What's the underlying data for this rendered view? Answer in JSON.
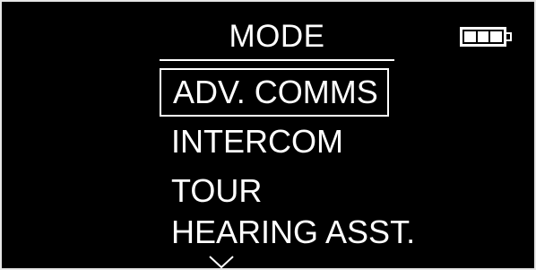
{
  "screen": {
    "title": "MODE",
    "battery": {
      "icon": "battery-icon",
      "level": "3 of 3 bars"
    },
    "menu": {
      "items": [
        {
          "label": "ADV. COMMS",
          "selected": true
        },
        {
          "label": "INTERCOM",
          "selected": false
        },
        {
          "label": "TOUR",
          "selected": false
        },
        {
          "label": "HEARING ASST.",
          "selected": false
        }
      ]
    },
    "scroll_indicator": {
      "icon": "chevron-down-icon"
    }
  },
  "colors": {
    "background": "#000000",
    "foreground": "#ffffff",
    "bezel": "#e6e6e6"
  }
}
